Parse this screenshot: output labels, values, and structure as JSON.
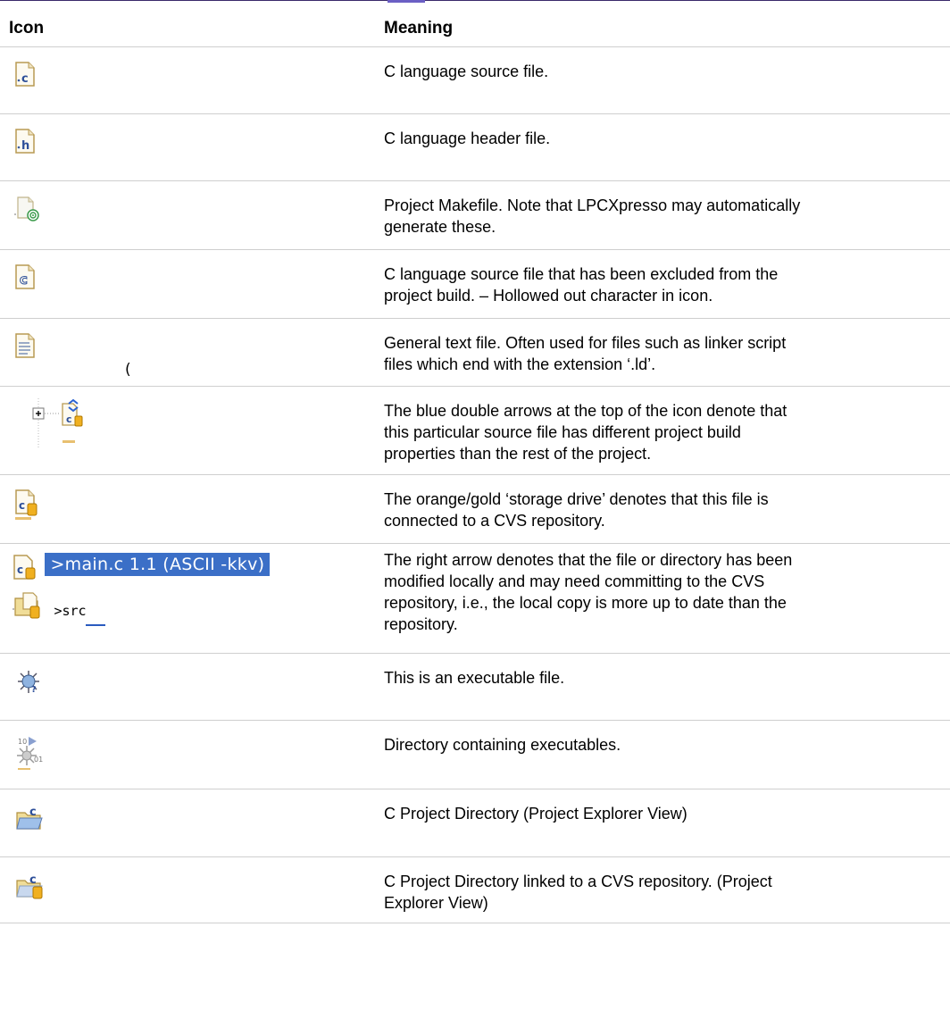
{
  "table": {
    "headers": {
      "icon": "Icon",
      "meaning": "Meaning"
    },
    "rows": [
      {
        "icon": "c-source-file-icon",
        "meaning": [
          "C language source file."
        ]
      },
      {
        "icon": "c-header-file-icon",
        "meaning": [
          "C language header file."
        ]
      },
      {
        "icon": "makefile-icon",
        "meaning": [
          "Project Makefile. Note that LPCXpresso may automatically",
          "generate these."
        ]
      },
      {
        "icon": "excluded-c-source-file-icon",
        "meaning": [
          "C language source file that has been excluded from the",
          "project build. – Hollowed out character in icon."
        ]
      },
      {
        "icon": "text-file-icon",
        "meaning": [
          "General text file. Often used for files such as linker script",
          "files which end with the extension ‘.ld’."
        ]
      },
      {
        "icon": "custom-build-properties-icon",
        "icon_text": "(",
        "meaning": [
          "The blue double arrows at the top of the icon denote that",
          "this particular source file has different project build",
          "properties than the rest of the project."
        ]
      },
      {
        "icon": "cvs-connected-file-icon",
        "meaning": [
          "The orange/gold ‘storage drive’ denotes that this file is",
          "connected to a CVS repository."
        ]
      },
      {
        "icon": "cvs-modified-icon",
        "icon_text_1": ">main.c  1.1  (ASCII -kkv)",
        "icon_text_2": ">src",
        "meaning": [
          "The right arrow denotes that the file or directory has been",
          "modified locally and may need committing to the CVS",
          "repository, i.e., the local copy is more up to date than the",
          "repository."
        ]
      },
      {
        "icon": "executable-file-icon",
        "meaning": [
          "This is an executable file."
        ]
      },
      {
        "icon": "executables-directory-icon",
        "meaning": [
          "Directory containing executables."
        ]
      },
      {
        "icon": "c-project-directory-icon",
        "meaning": [
          "C Project Directory (Project Explorer View)"
        ]
      },
      {
        "icon": "c-project-cvs-directory-icon",
        "meaning": [
          "C Project Directory linked to a CVS repository. (Project",
          "Explorer View)"
        ]
      }
    ]
  }
}
